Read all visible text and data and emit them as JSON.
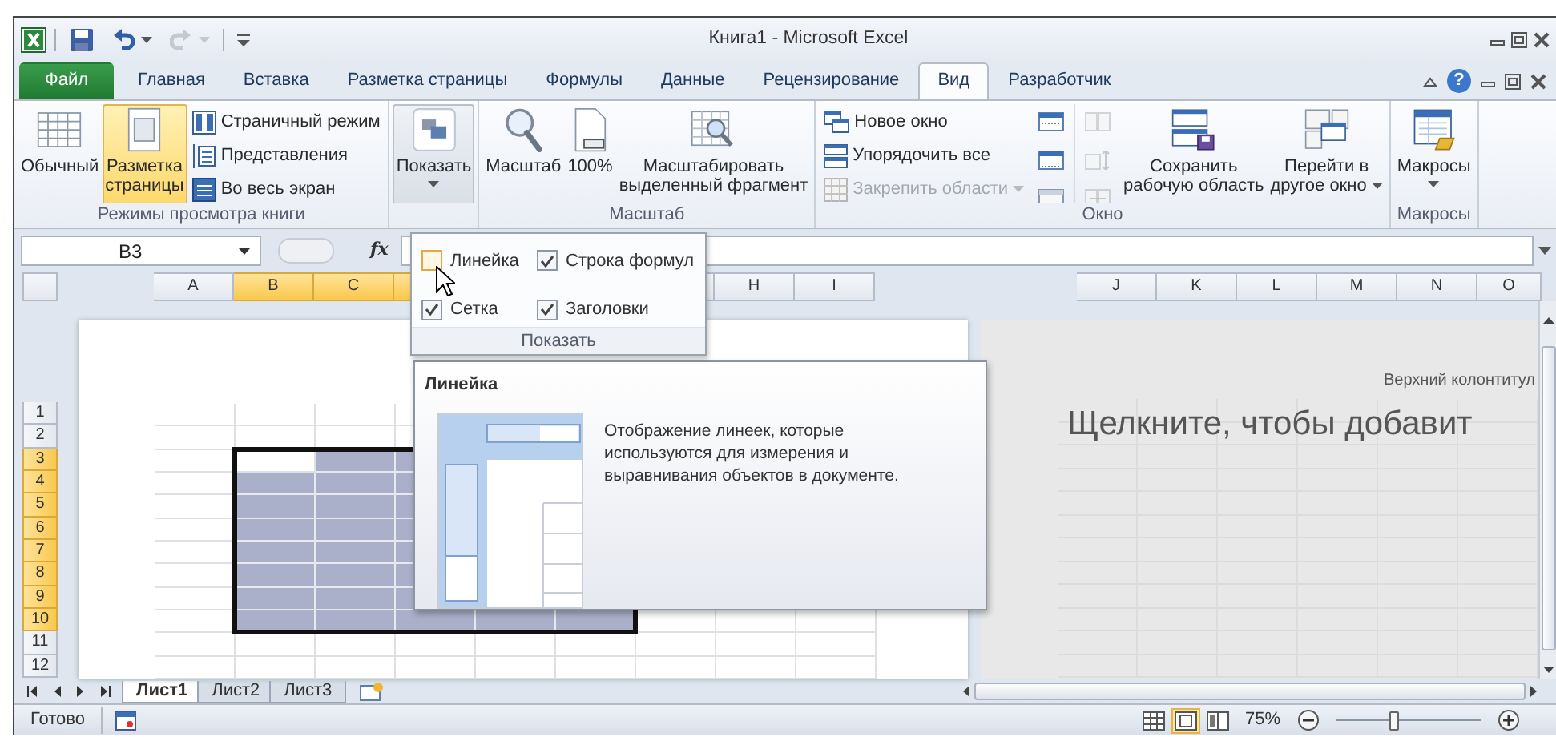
{
  "window": {
    "title": "Книга1 - Microsoft Excel"
  },
  "quick_access": [
    {
      "kind": "save",
      "disabled": false
    },
    {
      "kind": "undo",
      "disabled": false
    },
    {
      "kind": "redo",
      "disabled": true
    }
  ],
  "tabs": [
    {
      "label": "Файл",
      "kind": "file",
      "selected": false
    },
    {
      "label": "Главная",
      "kind": "tab",
      "selected": false
    },
    {
      "label": "Вставка",
      "kind": "tab",
      "selected": false
    },
    {
      "label": "Разметка страницы",
      "kind": "tab",
      "selected": false
    },
    {
      "label": "Формулы",
      "kind": "tab",
      "selected": false
    },
    {
      "label": "Данные",
      "kind": "tab",
      "selected": false
    },
    {
      "label": "Рецензирование",
      "kind": "tab",
      "selected": false
    },
    {
      "label": "Вид",
      "kind": "tab",
      "selected": true
    },
    {
      "label": "Разработчик",
      "kind": "tab",
      "selected": false
    }
  ],
  "help_button": "?",
  "ribbon": {
    "groups": [
      {
        "label": "Режимы просмотра книги",
        "items": [
          {
            "kind": "large",
            "label": "Обычный",
            "selected": false
          },
          {
            "kind": "large",
            "label": "Разметка\nстраницы",
            "selected": true
          },
          {
            "kind": "column",
            "buttons": [
              {
                "label": "Страничный режим",
                "disabled": false
              },
              {
                "label": "Представления",
                "disabled": false
              },
              {
                "label": "Во весь экран",
                "disabled": false
              }
            ]
          }
        ]
      },
      {
        "items": [
          {
            "kind": "large",
            "label": "Показать",
            "dropdown": true,
            "pressed": true
          }
        ]
      },
      {
        "label": "Масштаб",
        "items": [
          {
            "kind": "large",
            "label": "Масштаб"
          },
          {
            "kind": "large",
            "label": "100%"
          },
          {
            "kind": "large",
            "label": "Масштабировать\nвыделенный фрагмент"
          }
        ]
      },
      {
        "label": "Окно",
        "items": [
          {
            "kind": "column",
            "buttons": [
              {
                "label": "Новое окно",
                "disabled": false
              },
              {
                "label": "Упорядочить все",
                "disabled": false
              },
              {
                "label": "Закрепить области",
                "disabled": true,
                "dropdown": true
              }
            ]
          },
          {
            "kind": "icons",
            "buttons": [
              {
                "disabled": false
              },
              {
                "disabled": false
              },
              {
                "disabled": false
              }
            ]
          },
          {
            "kind": "icons",
            "buttons": [
              {
                "disabled": true
              },
              {
                "disabled": true
              },
              {
                "disabled": true
              }
            ]
          },
          {
            "kind": "large",
            "label": "Сохранить\nрабочую область"
          },
          {
            "kind": "large",
            "label": "Перейти в\nдругое окно",
            "dropdown": true
          }
        ]
      },
      {
        "label": "Макросы",
        "items": [
          {
            "kind": "large",
            "label": "Макросы",
            "dropdown": true
          }
        ]
      }
    ]
  },
  "formula_bar": {
    "name_box": "B3",
    "function_button": "fx"
  },
  "show_menu": {
    "options": [
      {
        "label": "Линейка",
        "checked": false,
        "highlighted": true
      },
      {
        "label": "Строка формул",
        "checked": true,
        "highlighted": false
      },
      {
        "label": "Сетка",
        "checked": true,
        "highlighted": false
      },
      {
        "label": "Заголовки",
        "checked": true,
        "highlighted": false
      }
    ],
    "label": "Показать"
  },
  "tooltip": {
    "title": "Линейка",
    "text": "Отображение линеек, которые используются для измерения и выравнивания объектов в документе."
  },
  "columns": [
    {
      "label": "A",
      "selected": false
    },
    {
      "label": "B",
      "selected": true
    },
    {
      "label": "C",
      "selected": true
    },
    {
      "selected": true
    },
    {
      "selected": true
    },
    {
      "selected": true
    },
    {
      "selected": false
    },
    {
      "label": "H",
      "selected": false
    },
    {
      "label": "I",
      "selected": false
    }
  ],
  "columns_right": [
    "J",
    "K",
    "L",
    "M",
    "N",
    "O"
  ],
  "rows": [
    {
      "label": "1",
      "selected": false
    },
    {
      "label": "2",
      "selected": false
    },
    {
      "label": "3",
      "selected": true
    },
    {
      "label": "4",
      "selected": true
    },
    {
      "label": "5",
      "selected": true
    },
    {
      "label": "6",
      "selected": true
    },
    {
      "label": "7",
      "selected": true
    },
    {
      "label": "8",
      "selected": true
    },
    {
      "label": "9",
      "selected": true
    },
    {
      "label": "10",
      "selected": true
    },
    {
      "label": "11",
      "selected": false
    },
    {
      "label": "12",
      "selected": false
    }
  ],
  "next_page": {
    "header": "Верхний колонтитул",
    "placeholder": "Щелкните, чтобы добавит"
  },
  "sheets": [
    {
      "label": "Лист1",
      "selected": true
    },
    {
      "label": "Лист2",
      "selected": false
    },
    {
      "label": "Лист3",
      "selected": false
    }
  ],
  "status_bar": {
    "status": "Готово",
    "views": [
      {
        "kind": "normal",
        "selected": false
      },
      {
        "kind": "layout",
        "selected": true
      },
      {
        "kind": "pagebreak",
        "selected": false
      }
    ],
    "zoom": "75%",
    "zoom_slider": {
      "level": 0.4
    }
  }
}
